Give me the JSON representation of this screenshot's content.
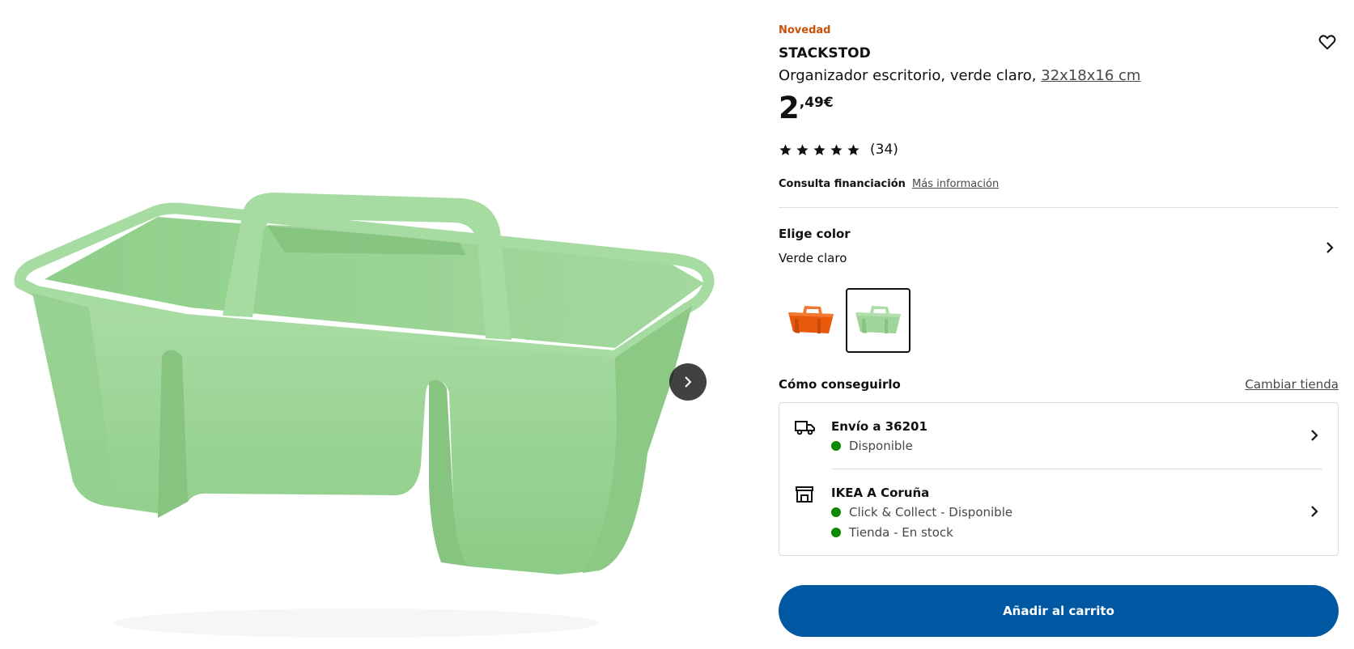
{
  "product": {
    "badge": "Novedad",
    "name": "STACKSTOD",
    "description": "Organizador escritorio, verde claro,",
    "dimensions": "32x18x16 cm",
    "price_integer": "2",
    "price_decimal": ",49€",
    "rating_stars": 5,
    "rating_count": "(34)"
  },
  "financing": {
    "label": "Consulta financiación",
    "link": "Más información"
  },
  "color": {
    "title": "Elige color",
    "selected": "Verde claro",
    "swatches": [
      {
        "name": "orange",
        "hex": "#e8590c",
        "selected": false
      },
      {
        "name": "light-green",
        "hex": "#9ed59a",
        "selected": true
      }
    ]
  },
  "availability": {
    "title": "Cómo conseguirlo",
    "change_store": "Cambiar tienda",
    "delivery": {
      "icon": "truck-icon",
      "title": "Envío a 36201",
      "status": "Disponible"
    },
    "store": {
      "icon": "store-icon",
      "title": "IKEA A Coruña",
      "status_1": "Click & Collect - Disponible",
      "status_2": "Tienda - En stock"
    }
  },
  "cart": {
    "button_label": "Añadir al carrito"
  },
  "colors": {
    "accent_blue": "#0058a3",
    "badge_orange": "#ca5008",
    "stock_green": "#0a8a00",
    "product_green": "#9ed59a"
  }
}
